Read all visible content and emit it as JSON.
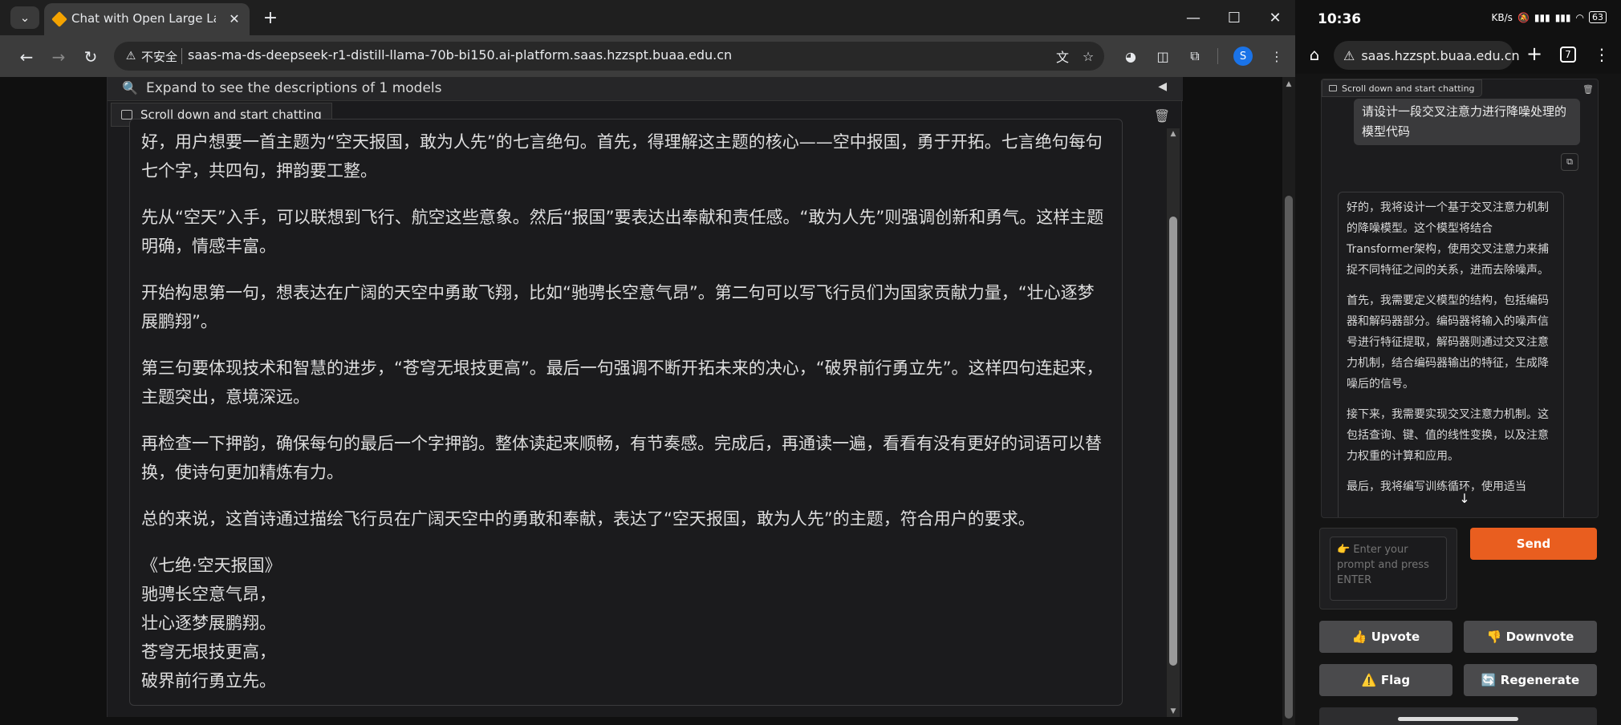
{
  "desktop": {
    "tab": {
      "title": "Chat with Open Large Langu"
    },
    "address": {
      "security_label": "不安全",
      "url": "saas-ma-ds-deepseek-r1-distill-llama-70b-bi150.ai-platform.saas.hzzspt.buaa.edu.cn"
    },
    "profile_initial": "S",
    "app": {
      "expand_text": "Expand to see the descriptions of 1 models",
      "chat_label": "Scroll down and start chatting",
      "message_paragraphs": [
        "好，用户想要一首主题为“空天报国，敢为人先”的七言绝句。首先，得理解这主题的核心——空中报国，勇于开拓。七言绝句每句七个字，共四句，押韵要工整。",
        "先从“空天”入手，可以联想到飞行、航空这些意象。然后“报国”要表达出奉献和责任感。“敢为人先”则强调创新和勇气。这样主题明确，情感丰富。",
        "开始构思第一句，想表达在广阔的天空中勇敢飞翔，比如“驰骋长空意气昂”。第二句可以写飞行员们为国家贡献力量，“壮心逐梦展鹏翔”。",
        "第三句要体现技术和智慧的进步，“苍穹无垠技更高”。最后一句强调不断开拓未来的决心，“破界前行勇立先”。这样四句连起来，主题突出，意境深远。",
        "再检查一下押韵，确保每句的最后一个字押韵。整体读起来顺畅，有节奏感。完成后，再通读一遍，看看有没有更好的词语可以替换，使诗句更加精炼有力。",
        "总的来说，这首诗通过描绘飞行员在广阔天空中的勇敢和奉献，表达了“空天报国，敢为人先”的主题，符合用户的要求。"
      ],
      "poem": [
        "《七绝·空天报国》",
        "驰骋长空意气昂，",
        "壮心逐梦展鹏翔。",
        "苍穹无垠技更高，",
        "破界前行勇立先。"
      ]
    }
  },
  "mobile": {
    "status": {
      "time": "10:36",
      "net": "KB/s",
      "battery": "63"
    },
    "url": "saas.hzzspt.buaa.edu.cn",
    "tab_count": "7",
    "chat_label": "Scroll down and start chatting",
    "user_message": "请设计一段交叉注意力进行降噪处理的模型代码",
    "bot_paragraphs": [
      "好的，我将设计一个基于交叉注意力机制的降噪模型。这个模型将结合Transformer架构，使用交叉注意力来捕捉不同特征之间的关系，进而去除噪声。",
      "首先，我需要定义模型的结构，包括编码器和解码器部分。编码器将输入的噪声信号进行特征提取，解码器则通过交叉注意力机制，结合编码器输出的特征，生成降噪后的信号。",
      "接下来，我需要实现交叉注意力机制。这包括查询、键、值的线性变换，以及注意力权重的计算和应用。",
      "最后，我将编写训练循环，使用适当"
    ],
    "input_placeholder": "👉 Enter your prompt and press ENTER",
    "send_label": "Send",
    "upvote_label": "👍 Upvote",
    "downvote_label": "👎 Downvote",
    "flag_label": "⚠️ Flag",
    "regenerate_label": "🔄 Regenerate"
  }
}
